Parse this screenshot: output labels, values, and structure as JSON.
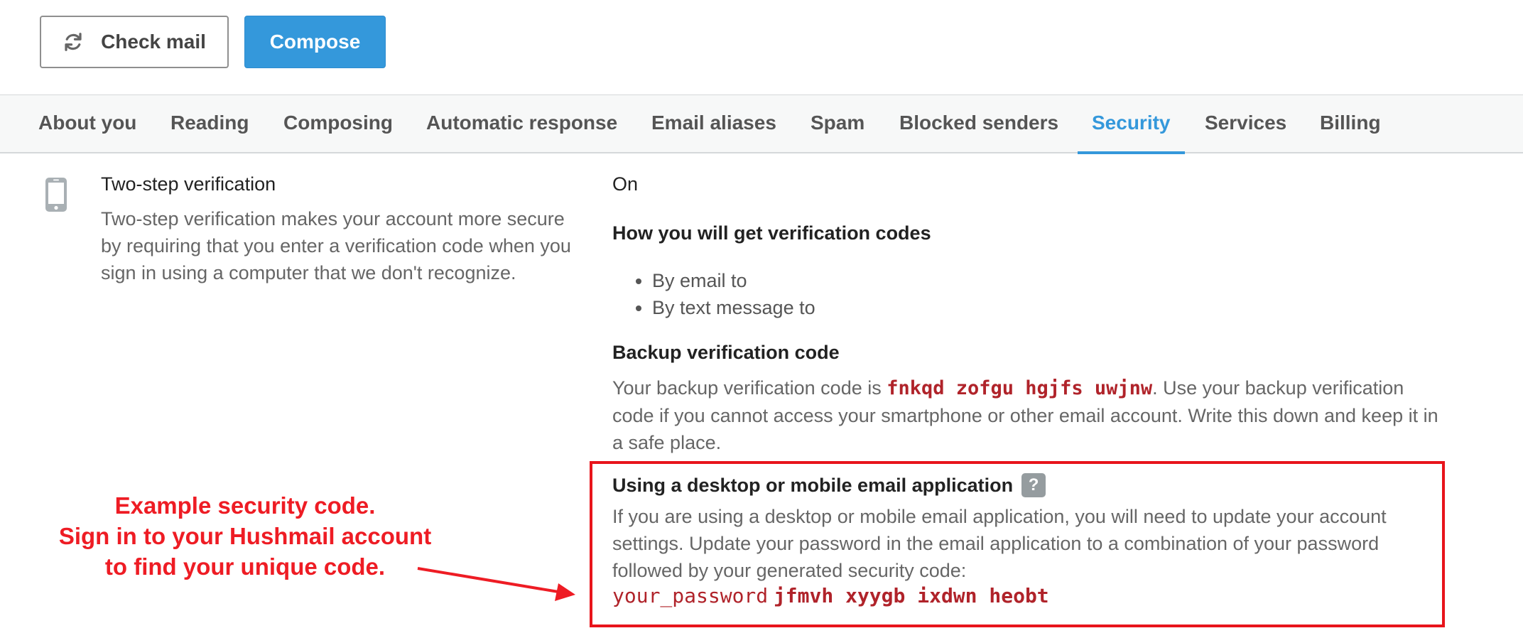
{
  "toolbar": {
    "check_mail_label": "Check mail",
    "compose_label": "Compose"
  },
  "tabs": [
    {
      "label": "About you",
      "active": false
    },
    {
      "label": "Reading",
      "active": false
    },
    {
      "label": "Composing",
      "active": false
    },
    {
      "label": "Automatic response",
      "active": false
    },
    {
      "label": "Email aliases",
      "active": false
    },
    {
      "label": "Spam",
      "active": false
    },
    {
      "label": "Blocked senders",
      "active": false
    },
    {
      "label": "Security",
      "active": true
    },
    {
      "label": "Services",
      "active": false
    },
    {
      "label": "Billing",
      "active": false
    }
  ],
  "two_step": {
    "icon": "phone-icon",
    "title": "Two-step verification",
    "description": "Two-step verification makes your account more secure by requiring that you enter a verification code when you sign in using a computer that we don't recognize.",
    "status": "On"
  },
  "verification": {
    "heading": "How you will get verification codes",
    "methods": [
      "By email to",
      "By text message to"
    ]
  },
  "backup": {
    "heading": "Backup verification code",
    "text_before": "Your backup verification code is ",
    "code": "fnkqd zofgu hgjfs uwjnw",
    "text_after": ". Use your backup verification code if you cannot access your smartphone or other email account. Write this down and keep it in a safe place."
  },
  "desktop_app": {
    "heading": "Using a desktop or mobile email application",
    "help_label": "?",
    "description": "If you are using a desktop or mobile email application, you will need to update your account settings. Update your password in the email application to a combination of your password followed by your generated security code:",
    "password_placeholder": "your_password",
    "security_code": "jfmvh xyygb ixdwn heobt"
  },
  "annotation": {
    "lines": [
      "Example security code.",
      "Sign in to your Hushmail account",
      "to find your unique code."
    ]
  },
  "colors": {
    "accent": "#3498db",
    "code_red": "#b0232a",
    "annotation_red": "#ee1c24"
  }
}
